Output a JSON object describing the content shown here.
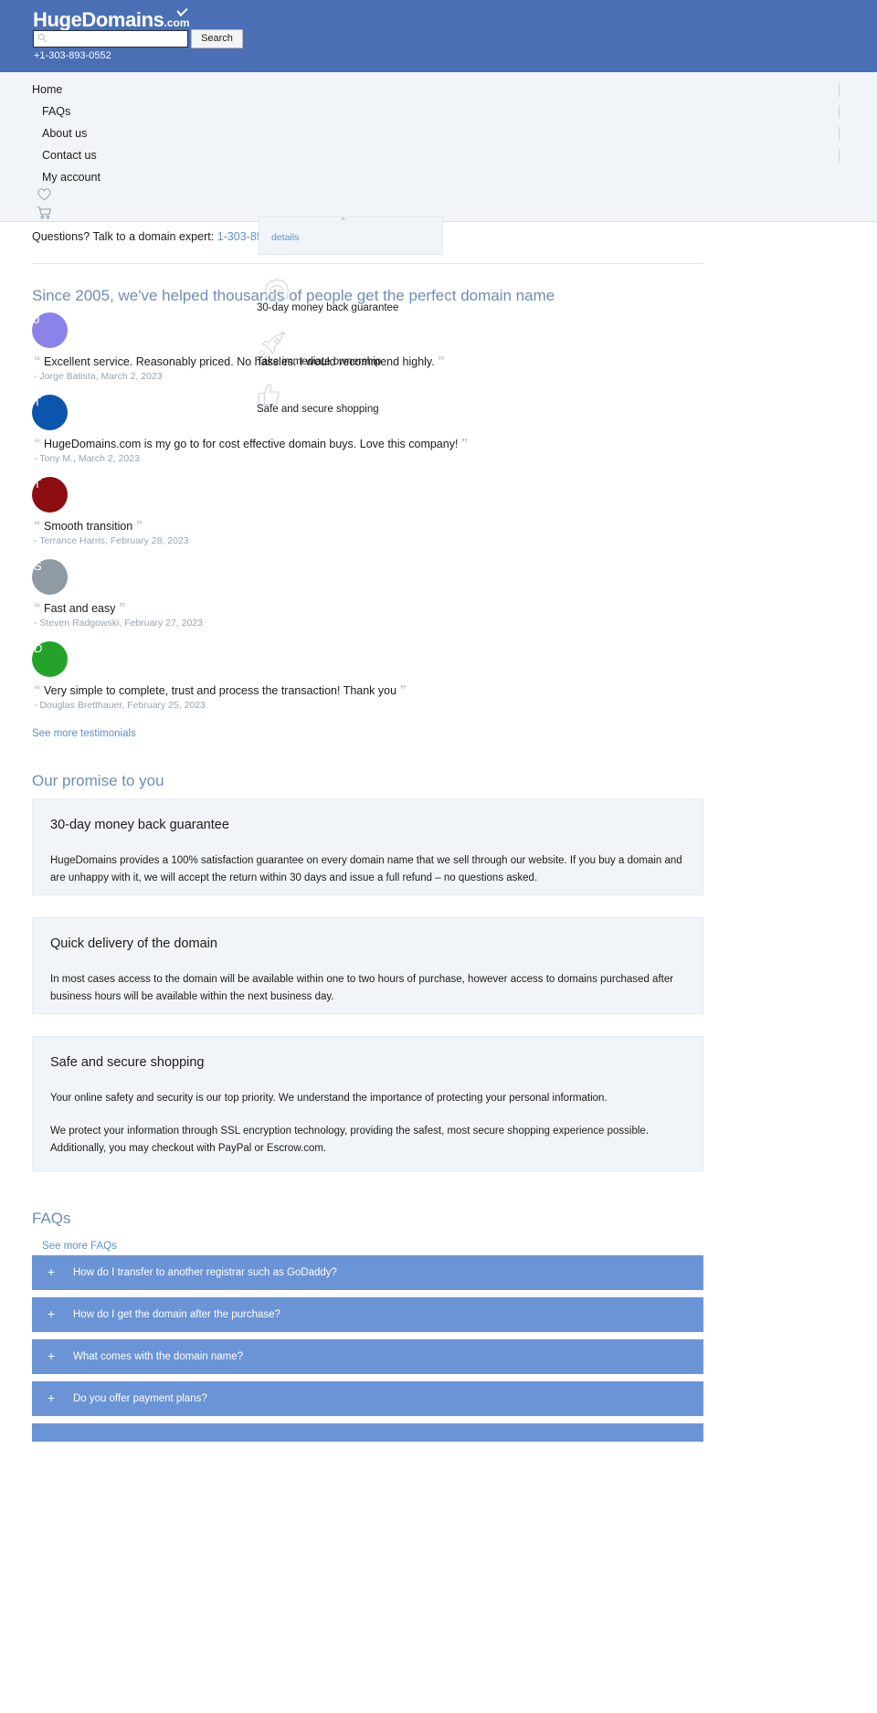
{
  "header": {
    "logo_main": "HugeDomains",
    "logo_suffix": ".com",
    "search_placeholder": "",
    "search_value": "",
    "search_button": "Search",
    "phone": "+1-303-893-0552",
    "brand_color": "#4a6fb5"
  },
  "nav": {
    "items": [
      {
        "label": "Home"
      },
      {
        "label": "FAQs"
      },
      {
        "label": "About us"
      },
      {
        "label": "Contact us"
      },
      {
        "label": "My account"
      }
    ],
    "icons": [
      {
        "name": "heart-icon"
      },
      {
        "name": "cart-icon"
      }
    ]
  },
  "expert_bar": {
    "text": "Questions? Talk to a domain expert:",
    "phone": "1-303-893-0552"
  },
  "details_popup": {
    "link": "details"
  },
  "testimonials": {
    "heading": "Since 2005, we've helped thousands of people get the perfect domain name",
    "see_more": "See more testimonials",
    "items": [
      {
        "initial": "J",
        "color": "#8b83e8",
        "quote": "Excellent service. Reasonably priced. No hassles. I would recommend highly.",
        "attribution": "- Jorge Batista, March 2, 2023"
      },
      {
        "initial": "T",
        "color": "#0b55ac",
        "quote": "HugeDomains.com is my go to for cost effective domain buys. Love this company!",
        "attribution": "- Tony M., March 2, 2023"
      },
      {
        "initial": "T",
        "color": "#8c0d12",
        "quote": "Smooth transition",
        "attribution": "- Terrance Harris, February 28, 2023"
      },
      {
        "initial": "S",
        "color": "#909aa3",
        "quote": "Fast and easy",
        "attribution": "- Steven Radgowski, February 27, 2023"
      },
      {
        "initial": "D",
        "color": "#23a32a",
        "quote": "Very simple to complete, trust and process the transaction! Thank you",
        "attribution": "- Douglas Bretthauer, February 25, 2023"
      }
    ]
  },
  "badges_overlay": [
    {
      "icon": "seal-check-icon",
      "label": "30-day money back guarantee"
    },
    {
      "icon": "rocket-icon",
      "label": "Take immediate ownership"
    },
    {
      "icon": "thumbs-up-icon",
      "label": "Safe and secure shopping"
    }
  ],
  "promise": {
    "heading": "Our promise to you",
    "cards": [
      {
        "title": "30-day money back guarantee",
        "body": "HugeDomains provides a 100% satisfaction guarantee on every domain name that we sell through our website. If you buy a domain and are unhappy with it, we will accept the return within 30 days and issue a full refund – no questions asked."
      },
      {
        "title": "Quick delivery of the domain",
        "body": "In most cases access to the domain will be available within one to two hours of purchase, however access to domains purchased after business hours will be available within the next business day."
      },
      {
        "title": "Safe and secure shopping",
        "body1": "Your online safety and security is our top priority. We understand the importance of protecting your personal information.",
        "body2": "We protect your information through SSL encryption technology, providing the safest, most secure shopping experience possible. Additionally, you may checkout with PayPal or Escrow.com."
      }
    ]
  },
  "faqs": {
    "heading": "FAQs",
    "see_more": "See more FAQs",
    "expand_symbol": "+",
    "items": [
      {
        "question": "How do I transfer to another registrar such as GoDaddy?"
      },
      {
        "question": "How do I get the domain after the purchase?"
      },
      {
        "question": "What comes with the domain name?"
      },
      {
        "question": "Do you offer payment plans?"
      },
      {
        "question": ""
      }
    ]
  }
}
